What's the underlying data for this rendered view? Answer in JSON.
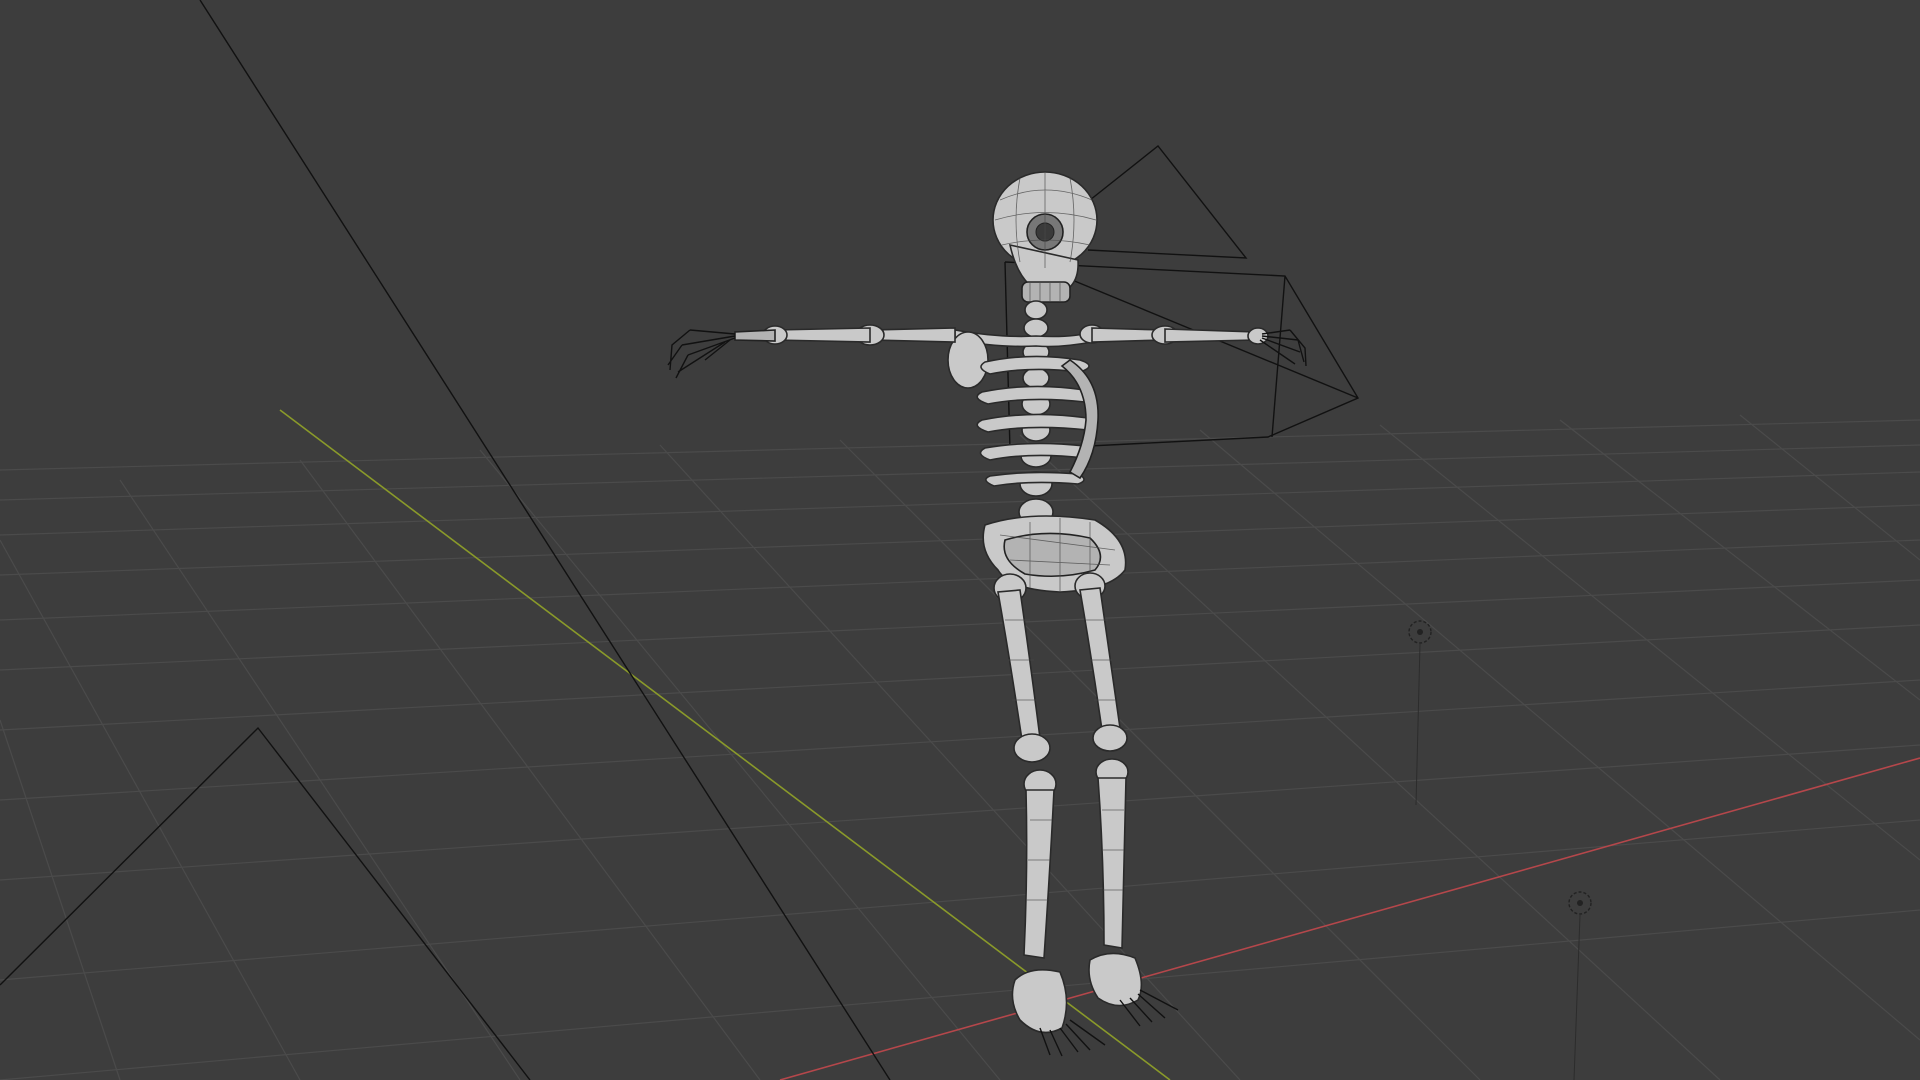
{
  "viewport": {
    "mode": "3D Viewport",
    "shading": "wireframe-overlay",
    "background_color": "#3d3d3d",
    "grid_color": "#4a4a4a",
    "x_axis_color": "#b5474b",
    "y_axis_color": "#8a9a2a"
  },
  "scene": {
    "main_object": "skeleton-mesh",
    "light_icons": [
      "light-icon",
      "light-icon"
    ],
    "camera_icons": [
      "camera-icon",
      "camera-icon"
    ]
  }
}
